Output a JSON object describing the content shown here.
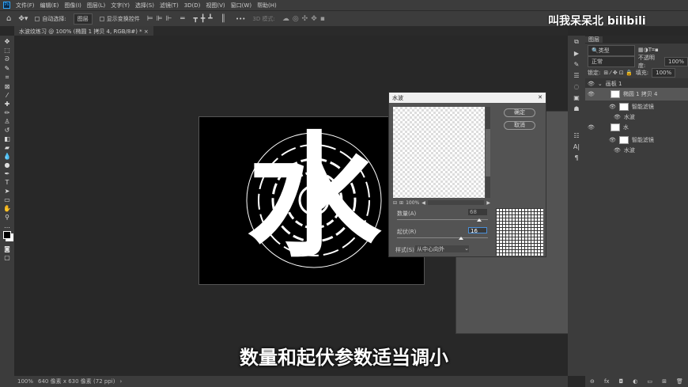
{
  "menu": [
    "文件(F)",
    "编辑(E)",
    "图像(I)",
    "图层(L)",
    "文字(Y)",
    "选择(S)",
    "滤镜(T)",
    "3D(D)",
    "视图(V)",
    "窗口(W)",
    "帮助(H)"
  ],
  "options": {
    "auto_select": "自动选择:",
    "layer_select": "图层",
    "show_transform": "显示变换控件",
    "mode3d": "3D 模式:"
  },
  "doc_tab": "水波纹练习 @ 100% (椭圆 1 拷贝 4, RGB/8#) *",
  "canvas_char": "水",
  "dialog": {
    "title": "水波",
    "ok": "确定",
    "cancel": "取消",
    "zoom": "100%",
    "amount_label": "数量(A)",
    "amount": "68",
    "ridges_label": "起伏(R)",
    "ridges": "16",
    "style_label": "样式(S)",
    "style": "从中心向外",
    "amount_pct": 0.9,
    "ridges_pct": 0.7
  },
  "layers": {
    "tab": "图层",
    "filter": "类型",
    "blend": "正常",
    "opacity_label": "不透明度:",
    "opacity": "100%",
    "lock_label": "锁定:",
    "fill_label": "填充:",
    "fill": "100%",
    "items": [
      {
        "name": "画板 1"
      },
      {
        "name": "椭圆 1 拷贝 4"
      },
      {
        "name": "智能滤镜"
      },
      {
        "name": "水波"
      },
      {
        "name": "水"
      },
      {
        "name": "智能滤镜"
      },
      {
        "name": "水波"
      }
    ]
  },
  "status": {
    "zoom": "100%",
    "size": "640 像素 x 630 像素 (72 ppi)"
  },
  "subtitle": "数量和起伏参数适当调小",
  "watermark": "叫我呆呆北 bilibili"
}
